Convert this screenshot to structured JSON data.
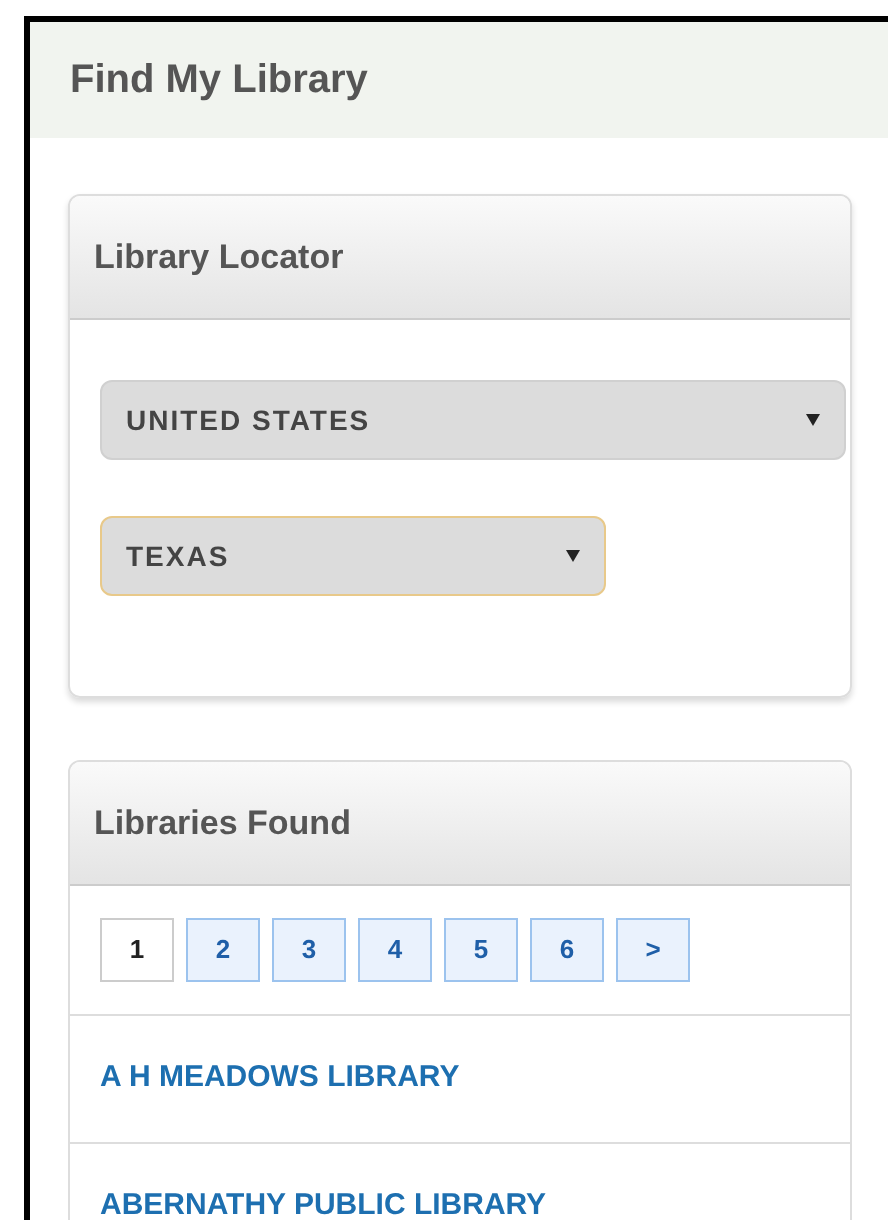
{
  "page": {
    "title": "Find My Library"
  },
  "locator": {
    "title": "Library Locator",
    "selects": [
      {
        "value": "UNITED STATES",
        "focused": false
      },
      {
        "value": "TEXAS",
        "focused": true
      }
    ]
  },
  "results": {
    "title": "Libraries Found",
    "pages": [
      {
        "label": "1",
        "selected": true
      },
      {
        "label": "2",
        "selected": false
      },
      {
        "label": "3",
        "selected": false
      },
      {
        "label": "4",
        "selected": false
      },
      {
        "label": "5",
        "selected": false
      },
      {
        "label": "6",
        "selected": false
      },
      {
        "label": ">",
        "selected": false
      }
    ],
    "libraries": [
      "A H MEADOWS LIBRARY",
      "ABERNATHY PUBLIC LIBRARY"
    ]
  }
}
